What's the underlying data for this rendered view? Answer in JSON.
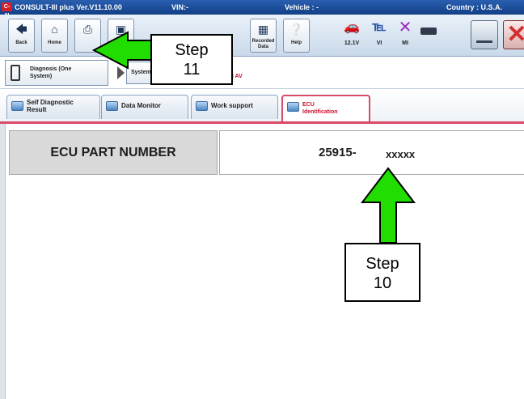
{
  "titlebar": {
    "logo": "C-III",
    "app_title": "CONSULT-III plus  Ver.V11.10.00",
    "vin_label": "VIN:-",
    "vehicle_label": "Vehicle : -",
    "country_label": "Country : U.S.A."
  },
  "toolbar": {
    "back_label": "Back",
    "home_label": "Home",
    "recorded_data_label": "Recorded\nData",
    "help_label": "Help",
    "voltage_label": "12.1V",
    "vi_label": "VI",
    "mi_label": "MI"
  },
  "breadcrumb": {
    "item1_label": "Diagnosis (One\nSystem)",
    "item2_label": "System Call",
    "item3_label": "MULTI AV"
  },
  "tabs": [
    {
      "label": "Self Diagnostic\nResult"
    },
    {
      "label": "Data Monitor"
    },
    {
      "label": "Work support"
    },
    {
      "label": "ECU\nIdentification"
    }
  ],
  "content": {
    "part_number_label": "ECU PART NUMBER",
    "part_number_value": "25915-",
    "part_number_masked": "xxxxx"
  },
  "callouts": {
    "step11": "Step\n11",
    "step10": "Step\n10"
  },
  "colors": {
    "arrow_fill": "#22dd00",
    "active_tab": "#c8102e"
  }
}
